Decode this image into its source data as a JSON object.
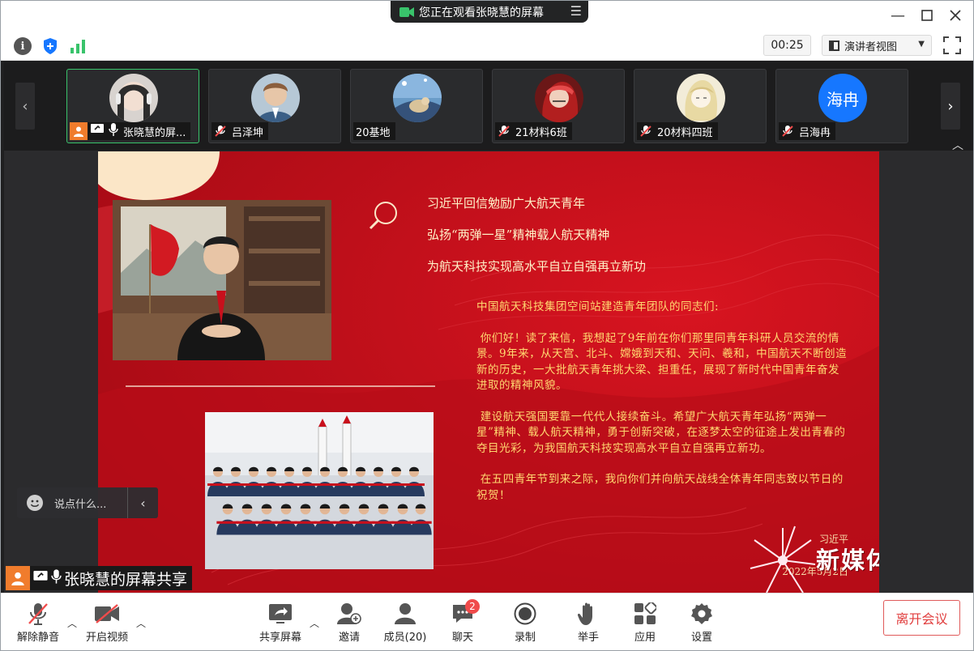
{
  "title_bar": {
    "share_status": "您正在观看张晓慧的屏幕",
    "menu_icon": "menu-lines-icon",
    "window_controls": [
      "minimize-icon",
      "maximize-icon",
      "close-icon"
    ]
  },
  "info_bar": {
    "icons": [
      "info-icon",
      "shield-icon",
      "signal-icon"
    ],
    "timer": "00:25",
    "view_mode": "演讲者视图",
    "fullscreen_icon": "fullscreen-icon"
  },
  "participants": [
    {
      "name": "张晓慧的屏...",
      "active": true,
      "avatar_color": "#d8d3cf",
      "hair": "#2d2d2d"
    },
    {
      "name": "吕泽坤",
      "active": false,
      "avatar_color": "#b6c8d6",
      "hair": "#8b5e3c"
    },
    {
      "name": "20基地",
      "active": false,
      "avatar_color": "#6a9cc8",
      "hair": "#d9c39a"
    },
    {
      "name": "21材料6班",
      "active": false,
      "avatar_color": "#6b1717",
      "hair": "#b21f1f"
    },
    {
      "name": "20材料四班",
      "active": false,
      "avatar_color": "#f2ecd8",
      "hair": "#e8d9a3"
    },
    {
      "name": "吕海冉",
      "active": false,
      "avatar_text": "海冉",
      "avatar_color": "#1677ff"
    }
  ],
  "slide": {
    "headlines": [
      "习近平回信勉励广大航天青年",
      "弘扬“两弹一星”精神载人航天精神",
      "为航天科技实现高水平自立自强再立新功"
    ],
    "letter": [
      "中国航天科技集团空间站建造青年团队的同志们:",
      " 你们好！读了来信，我想起了9年前在你们那里同青年科研人员交流的情景。9年来，从天宫、北斗、嫦娥到天和、天问、羲和，中国航天不断创造新的历史，一大批航天青年挑大梁、担重任，展现了新时代中国青年奋发进取的精神风貌。",
      " 建设航天强国要靠一代代人接续奋斗。希望广大航天青年弘扬“两弹一星”精神、载人航天精神，勇于创新突破，在逐梦太空的征途上发出青春的夺目光彩，为我国航天科技实现高水平自立自强再立新功。",
      " 在五四青年节到来之际，我向你们并向航天战线全体青年同志致以节日的祝贺！"
    ],
    "signature": "习近平",
    "date": "2022年5月2日",
    "watermark": "新媒体中心"
  },
  "chat_input": {
    "placeholder": "说点什么..."
  },
  "share_label": "张晓慧的屏幕共享",
  "toolbar": {
    "mute": "解除静音",
    "video": "开启视频",
    "share": "共享屏幕",
    "invite": "邀请",
    "members": "成员(20)",
    "chat": "聊天",
    "chat_badge": "2",
    "record": "录制",
    "raise_hand": "举手",
    "apps": "应用",
    "settings": "设置",
    "leave": "离开会议"
  }
}
